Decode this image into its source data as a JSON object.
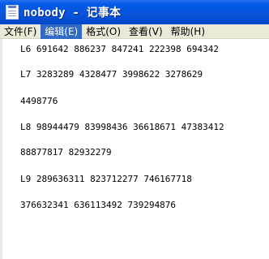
{
  "window": {
    "title": "nobody - 记事本"
  },
  "menu": {
    "file": "文件(F)",
    "edit": "编辑(E)",
    "format": "格式(O)",
    "view": "查看(V)",
    "help": "帮助(H)"
  },
  "content": {
    "lines": [
      "L6 691642 886237 847241 222398 694342",
      "L7 3283289 4328477 3998622 3278629",
      "4498776",
      "L8 98944479 83998436 36618671 47383412",
      "88877817 82932279",
      "L9 289636311 823712277 746167718",
      "376632341 636113492 739294876"
    ]
  }
}
